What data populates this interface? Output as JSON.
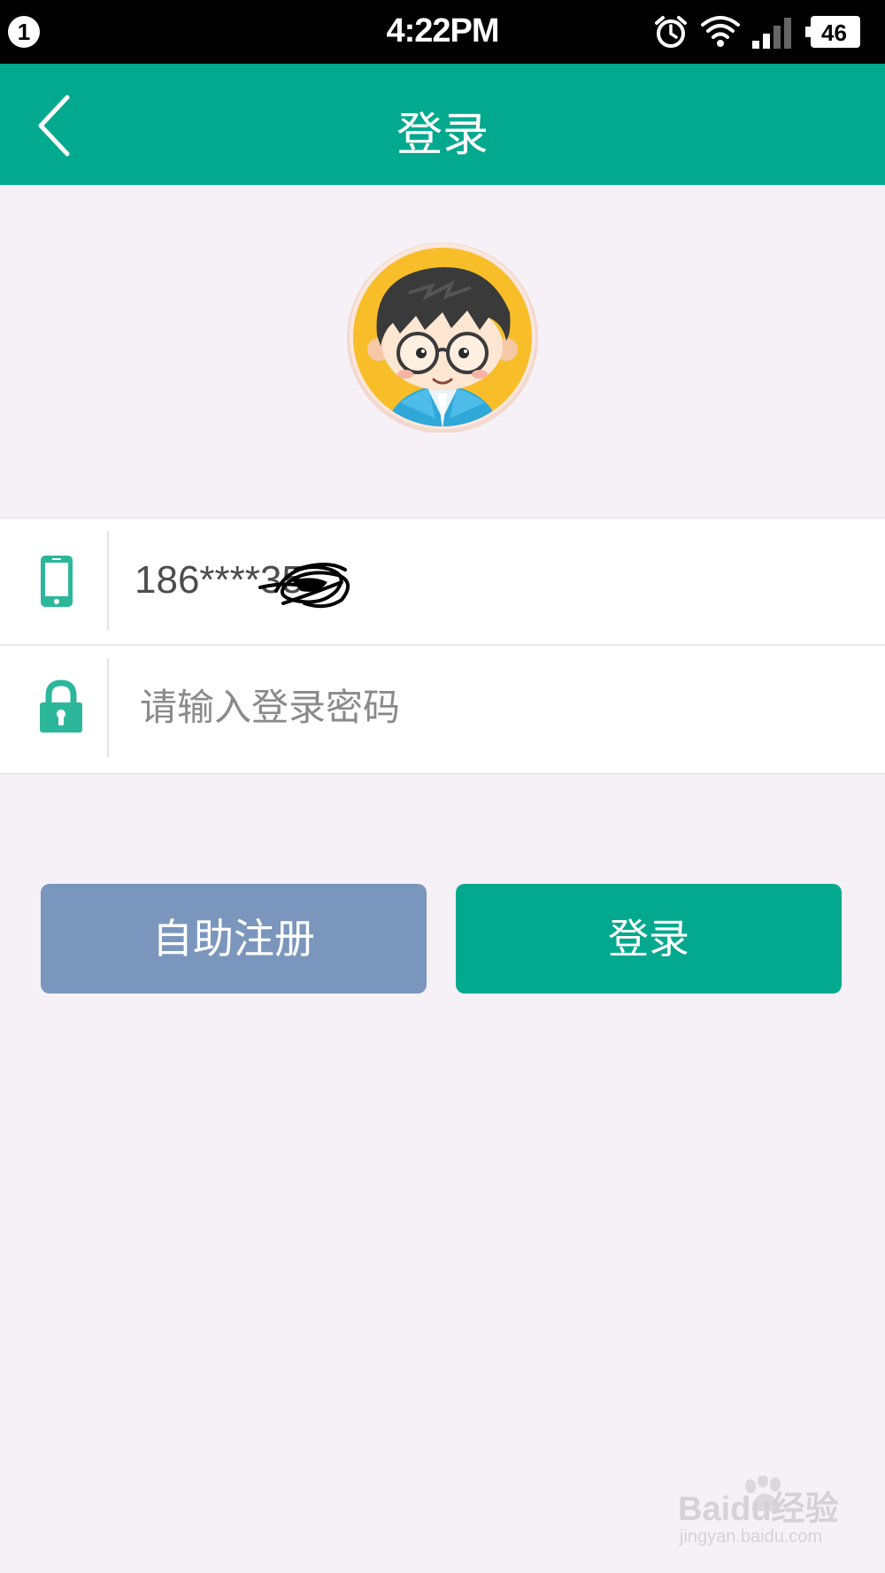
{
  "status_bar": {
    "notification_count": "1",
    "time": "4:22PM",
    "battery_level": "46",
    "icons": [
      "alarm-icon",
      "wifi-icon",
      "signal-icon",
      "battery-icon"
    ]
  },
  "header": {
    "title": "登录",
    "back_icon": "chevron-left-icon"
  },
  "avatar": {
    "icon": "cartoon-boy-avatar"
  },
  "form": {
    "phone": {
      "icon": "mobile-phone-icon",
      "value": "186****35"
    },
    "password": {
      "icon": "lock-icon",
      "value": "",
      "placeholder": "请输入登录密码"
    }
  },
  "buttons": {
    "register_label": "自助注册",
    "login_label": "登录"
  },
  "watermark": {
    "brand": "Baidu经验",
    "url": "jingyan.baidu.com"
  },
  "colors": {
    "primary": "#03a98f",
    "register_button": "#7b96bd",
    "background": "#f5f1f6",
    "avatar_ring": "#f7be2a"
  }
}
